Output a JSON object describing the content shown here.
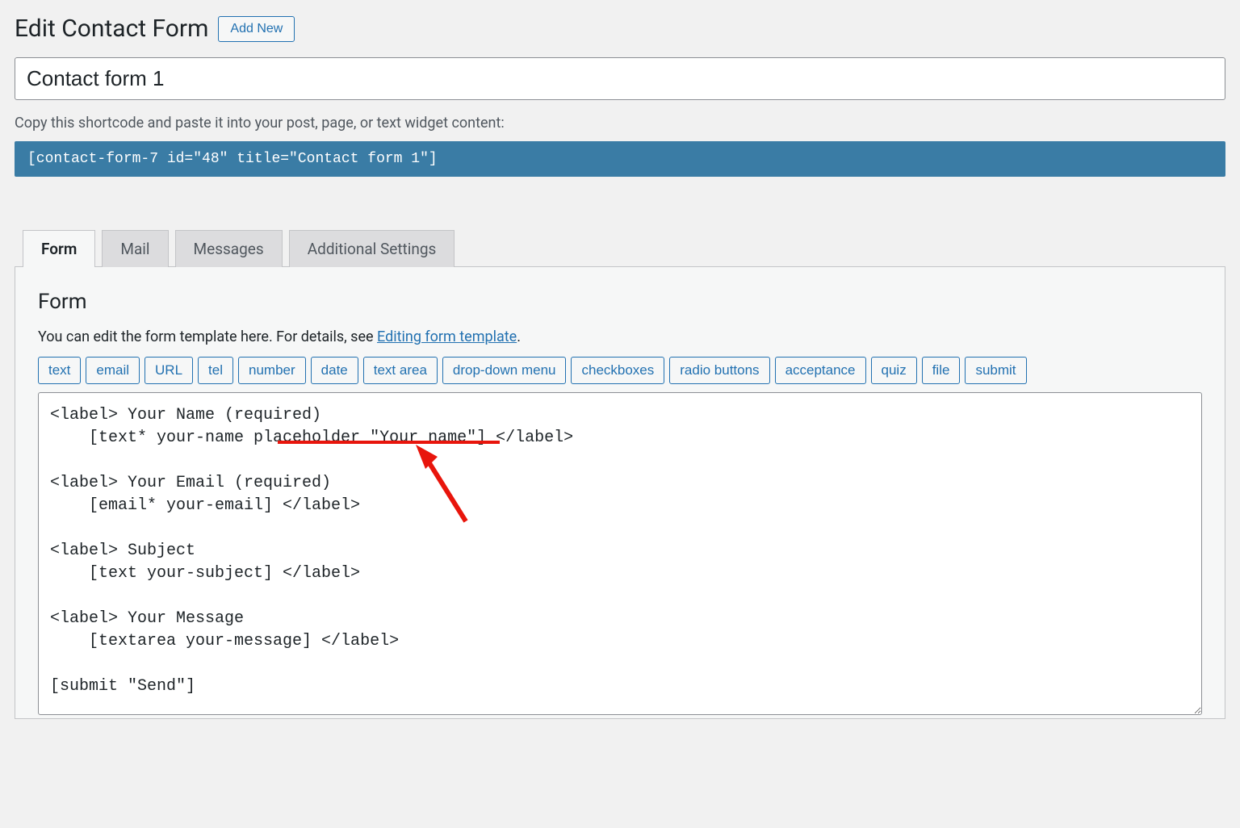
{
  "header": {
    "title": "Edit Contact Form",
    "add_new_label": "Add New"
  },
  "form_title_value": "Contact form 1",
  "shortcode": {
    "label": "Copy this shortcode and paste it into your post, page, or text widget content:",
    "value": "[contact-form-7 id=\"48\" title=\"Contact form 1\"]"
  },
  "tabs": [
    {
      "label": "Form",
      "active": true
    },
    {
      "label": "Mail",
      "active": false
    },
    {
      "label": "Messages",
      "active": false
    },
    {
      "label": "Additional Settings",
      "active": false
    }
  ],
  "panel": {
    "heading": "Form",
    "description_prefix": "You can edit the form template here. For details, see ",
    "description_link_text": "Editing form template",
    "description_suffix": ".",
    "tag_buttons": [
      "text",
      "email",
      "URL",
      "tel",
      "number",
      "date",
      "text area",
      "drop-down menu",
      "checkboxes",
      "radio buttons",
      "acceptance",
      "quiz",
      "file",
      "submit"
    ],
    "template_value": "<label> Your Name (required)\n    [text* your-name placeholder \"Your name\"] </label>\n\n<label> Your Email (required)\n    [email* your-email] </label>\n\n<label> Subject\n    [text your-subject] </label>\n\n<label> Your Message\n    [textarea your-message] </label>\n\n[submit \"Send\"]"
  },
  "colors": {
    "accent": "#2271b1",
    "shortcode_bg": "#3a7ca5",
    "annotation": "#e8150c"
  }
}
